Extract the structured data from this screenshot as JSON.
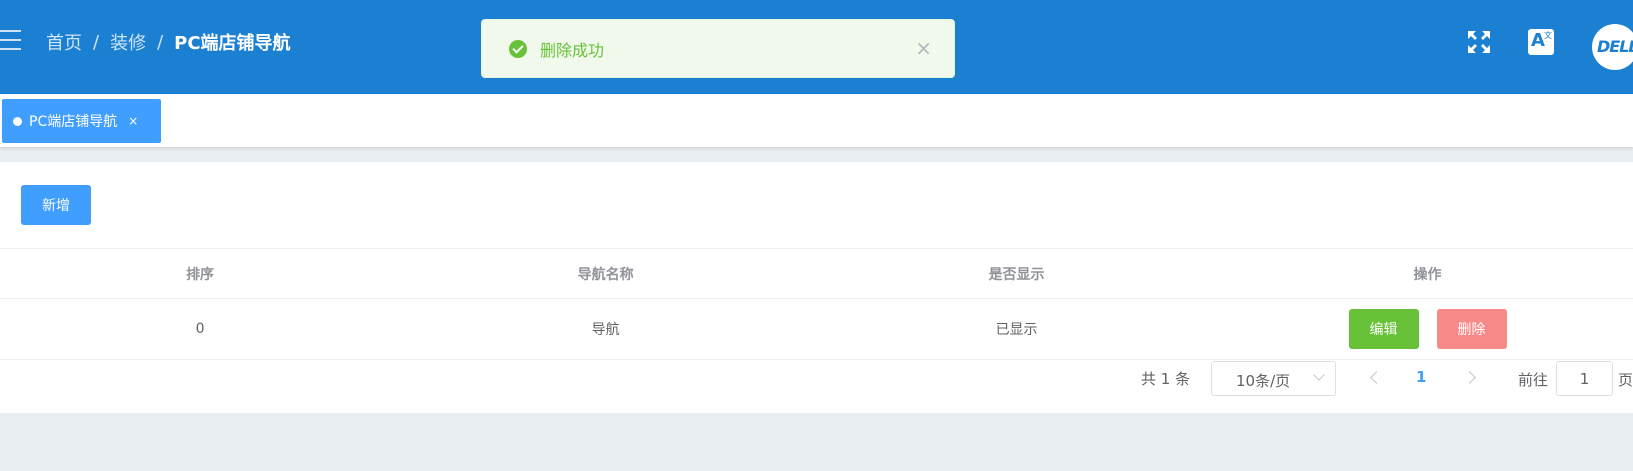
{
  "header": {
    "breadcrumb": [
      "首页",
      "装修",
      "PC端店铺导航"
    ],
    "separator": "/",
    "icons": [
      "menu-icon",
      "fullscreen-icon",
      "translate-icon"
    ],
    "translate_glyph": "A",
    "translate_glyph_zh": "文",
    "avatar_text": "DELL"
  },
  "toast": {
    "message": "删除成功",
    "close": "×",
    "type": "success"
  },
  "tags": [
    {
      "label": "PC端店铺导航",
      "close": "×",
      "active": true
    }
  ],
  "toolbar": {
    "add_label": "新增"
  },
  "table": {
    "columns": [
      "排序",
      "导航名称",
      "是否显示",
      "操作"
    ],
    "rows": [
      {
        "sort": "0",
        "name": "导航",
        "display": "已显示",
        "edit": "编辑",
        "delete": "删除"
      }
    ]
  },
  "pagination": {
    "total": "共 1 条",
    "page_size": "10条/页",
    "current_page": "1",
    "goto_label": "前往",
    "goto_value": "1",
    "goto_suffix": "页"
  },
  "colors": {
    "header": "#1b7fd2",
    "primary": "#409eff",
    "success": "#67c23a",
    "danger_light": "#f78989",
    "background": "#e9eef3"
  }
}
